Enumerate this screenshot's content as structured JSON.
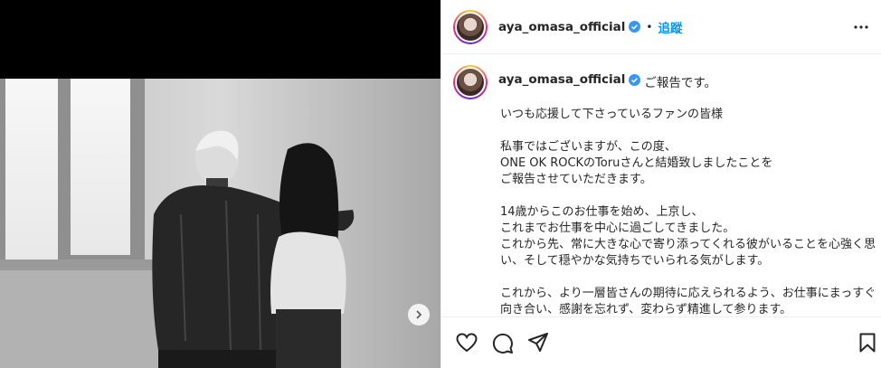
{
  "post": {
    "username": "aya_omasa_official",
    "follow_label": "追蹤",
    "dot": "•",
    "caption_first": "ご報告です。",
    "caption_body": "いつも応援して下さっているファンの皆様\n\n私事ではございますが、この度、\nONE OK ROCKのToruさんと結婚致しましたことを\nご報告させていただきます。\n\n14歳からこのお仕事を始め、上京し、\nこれまでお仕事を中心に過ごしてきました。\nこれから先、常に大きな心で寄り添ってくれる彼がいることを心強く思い、そして穏やかな気持ちでいられる気がします。\n\nこれから、より一層皆さんの期待に応えられるよう、お仕事にまっすぐ向き合い、感謝を忘れず、変わらず精進して参ります。"
  },
  "colors": {
    "accent": "#0095f6",
    "verified": "#3897f0",
    "text": "#262626",
    "divider": "#efefef"
  },
  "icons": {
    "verified": "verified-badge-icon",
    "more": "more-options-icon",
    "next": "chevron-right-icon",
    "like": "heart-icon",
    "comment": "comment-icon",
    "share": "share-icon",
    "save": "bookmark-icon"
  }
}
